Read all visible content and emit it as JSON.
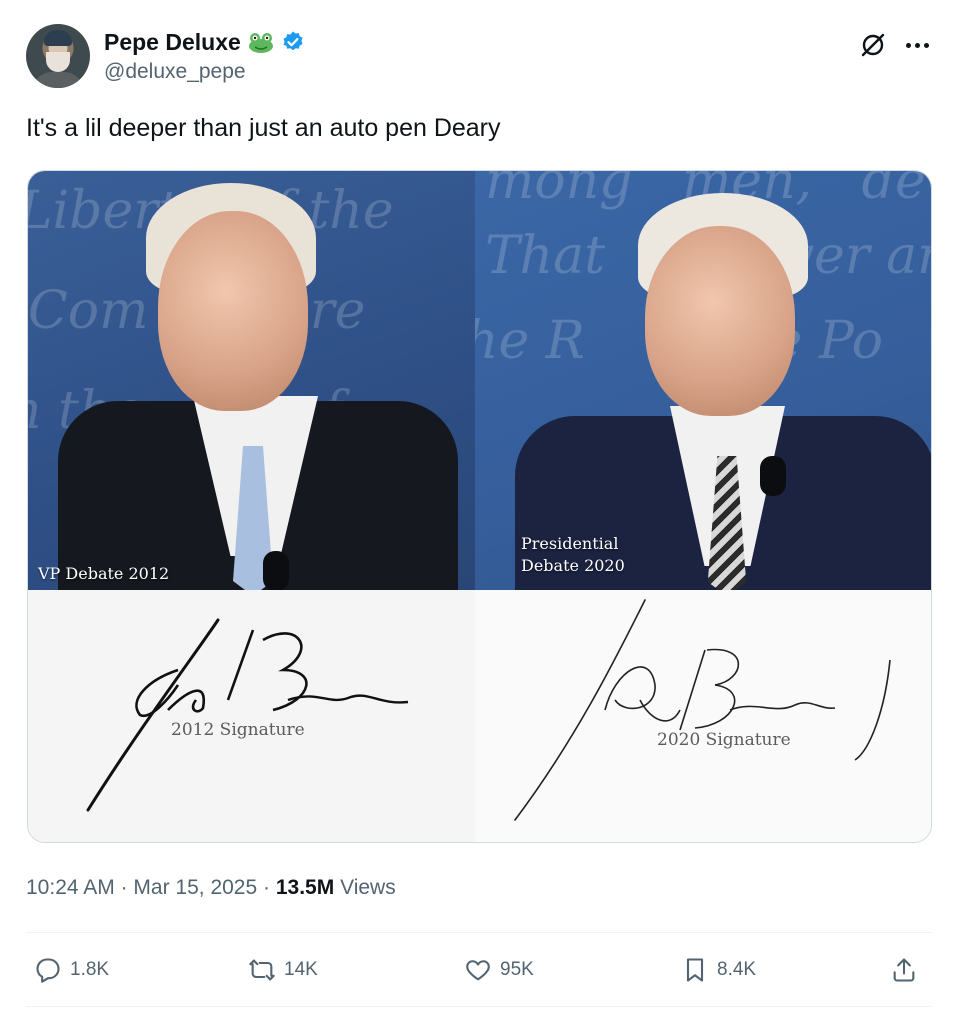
{
  "author": {
    "display_name": "Pepe Deluxe",
    "handle": "@deluxe_pepe",
    "badge_icon": "frog-emoji",
    "verified_icon": "verified-badge-icon",
    "verified_color": "#1d9bf0"
  },
  "tweet": {
    "text": "It's a lil deeper than just an auto pen Deary"
  },
  "media": {
    "left_photo_label": "VP Debate 2012",
    "right_photo_label_line1": "Presidential",
    "right_photo_label_line2": "Debate 2020",
    "left_signature_caption": "2012 Signature",
    "right_signature_caption": "2020 Signature"
  },
  "meta": {
    "time": "10:24 AM",
    "separator": "·",
    "date": "Mar 15, 2025",
    "views_count": "13.5M",
    "views_label": "Views"
  },
  "actions": {
    "replies": "1.8K",
    "reposts": "14K",
    "likes": "95K",
    "bookmarks": "8.4K"
  },
  "colors": {
    "text_primary": "#0f1419",
    "text_secondary": "#536471",
    "divider": "#eff3f4"
  }
}
